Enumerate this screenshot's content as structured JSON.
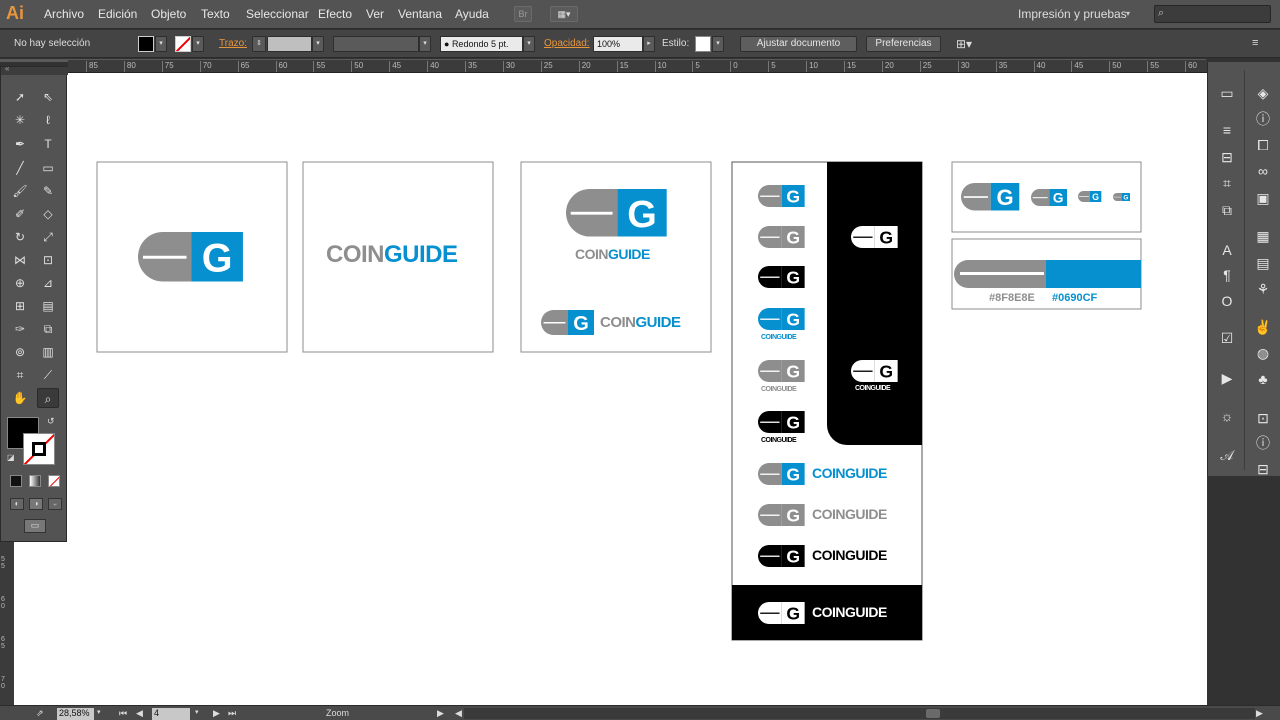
{
  "app": {
    "logo_text": "Ai"
  },
  "menu": [
    "Archivo",
    "Edición",
    "Objeto",
    "Texto",
    "Seleccionar",
    "Efecto",
    "Ver",
    "Ventana",
    "Ayuda"
  ],
  "bridge_button": "Br",
  "workspace": "Impresión y pruebas",
  "control": {
    "selection": "No hay selección",
    "stroke_label": "Trazo:",
    "brush": "Redondo 5 pt.",
    "opacity_label": "Opacidad:",
    "opacity_value": "100%",
    "style_label": "Estilo:",
    "adjust_button": "Ajustar documento",
    "prefs_button": "Preferencias"
  },
  "ruler_h": [
    "85",
    "80",
    "75",
    "70",
    "65",
    "60",
    "55",
    "50",
    "45",
    "40",
    "35",
    "30",
    "25",
    "20",
    "15",
    "10",
    "5",
    "0",
    "5",
    "10",
    "15",
    "20",
    "25",
    "30",
    "35",
    "40",
    "45",
    "50",
    "55",
    "60"
  ],
  "ruler_v": [
    "5 5",
    "6 0",
    "6 5",
    "7 0"
  ],
  "brand": {
    "word_coin": "COIN",
    "word_guide": "GUIDE",
    "letter": "G",
    "color_gray": "#8F8E8E",
    "color_blue": "#0690CF"
  },
  "swatches": [
    {
      "hex": "#8F8E8E",
      "label": "#8F8E8E"
    },
    {
      "hex": "#0690CF",
      "label": "#0690CF"
    }
  ],
  "status": {
    "zoom": "28,58%",
    "artboard": "4",
    "tool_name": "Zoom"
  },
  "colors": {
    "ui_dark": "#535353",
    "canvas": "#ffffff",
    "orange_label": "#e8963c"
  }
}
